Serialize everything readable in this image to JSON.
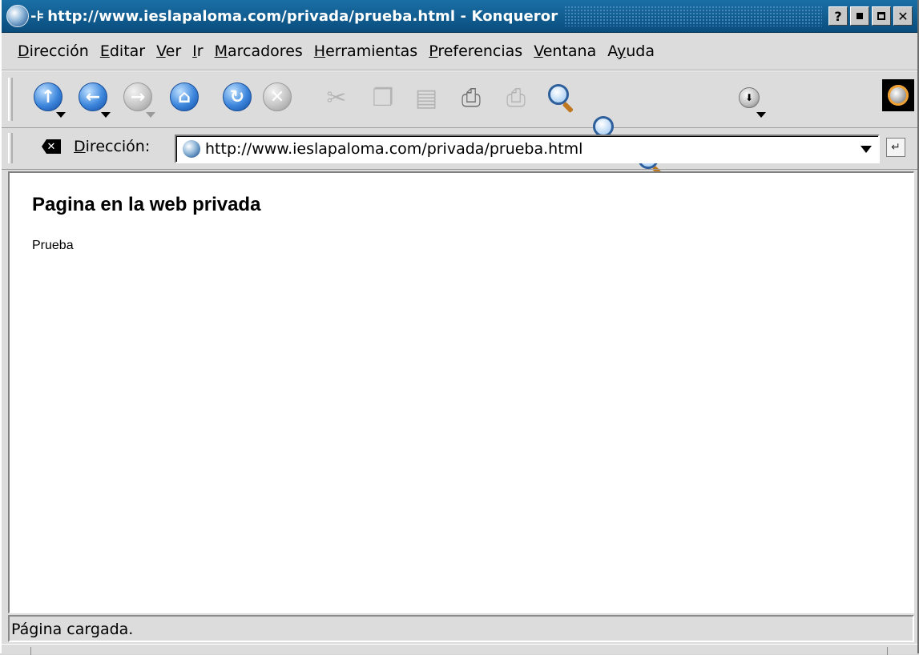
{
  "window": {
    "title": "http://www.ieslapaloma.com/privada/prueba.html - Konqueror",
    "buttons": {
      "help": "?"
    }
  },
  "menu": [
    {
      "label": "Dirección",
      "key": "D",
      "rest": "irección"
    },
    {
      "label": "Editar",
      "key": "E",
      "rest": "ditar"
    },
    {
      "label": "Ver",
      "key": "V",
      "rest": "er"
    },
    {
      "label": "Ir",
      "key": "I",
      "rest": "r"
    },
    {
      "label": "Marcadores",
      "key": "M",
      "rest": "arcadores"
    },
    {
      "label": "Herramientas",
      "key": "H",
      "rest": "erramientas"
    },
    {
      "label": "Preferencias",
      "key": "P",
      "rest": "referencias"
    },
    {
      "label": "Ventana",
      "key": "V",
      "rest": "entana"
    },
    {
      "label": "Ayuda",
      "pre": "A",
      "key": "y",
      "rest": "uda"
    }
  ],
  "toolbar": {
    "icons": [
      "up-icon",
      "back-icon",
      "forward-icon",
      "home-icon",
      "reload-icon",
      "stop-icon",
      "cut-icon",
      "copy-icon",
      "paste-icon",
      "print-icon",
      "print-frame-icon",
      "find-icon",
      "zoom-in-icon",
      "zoom-out-icon",
      "security-lock-icon",
      "download-icon",
      "gear-icon"
    ]
  },
  "location": {
    "label_key": "D",
    "label_rest": "irección:",
    "url": "http://www.ieslapaloma.com/privada/prueba.html"
  },
  "page": {
    "heading": "Pagina en la web privada",
    "paragraph": "Prueba"
  },
  "status": {
    "text": "Página cargada."
  }
}
